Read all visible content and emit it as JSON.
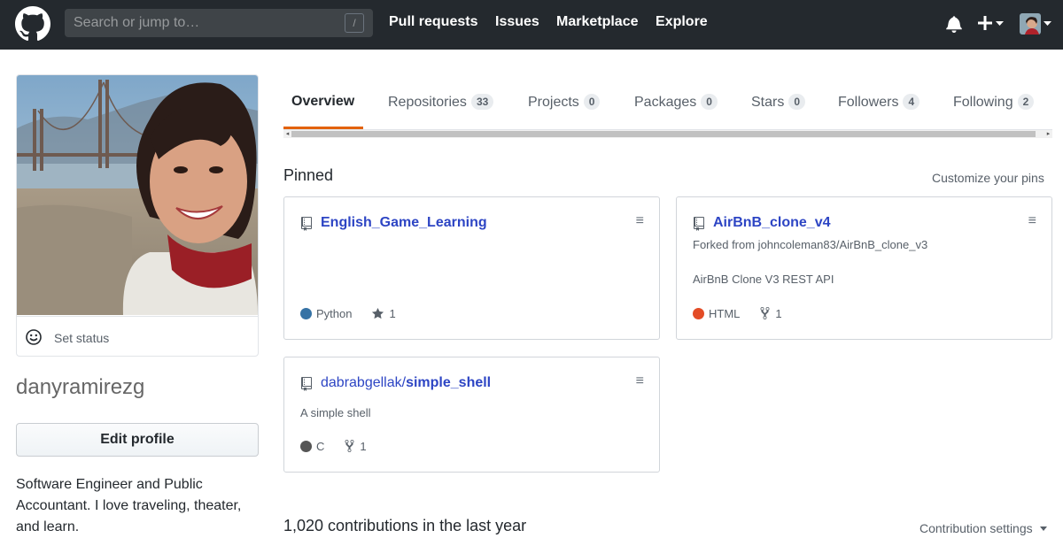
{
  "header": {
    "search_placeholder": "Search or jump to…",
    "search_shortcut": "/",
    "nav": [
      "Pull requests",
      "Issues",
      "Marketplace",
      "Explore"
    ],
    "plus_label": "+"
  },
  "profile": {
    "set_status": "Set status",
    "username": "danyramirezg",
    "edit_button": "Edit profile",
    "bio": "Software Engineer and Public Accountant. I love traveling, theater, and learn."
  },
  "tabs": [
    {
      "label": "Overview",
      "count": null,
      "active": true
    },
    {
      "label": "Repositories",
      "count": "33"
    },
    {
      "label": "Projects",
      "count": "0"
    },
    {
      "label": "Packages",
      "count": "0"
    },
    {
      "label": "Stars",
      "count": "0"
    },
    {
      "label": "Followers",
      "count": "4"
    },
    {
      "label": "Following",
      "count": "2"
    }
  ],
  "pinned": {
    "title": "Pinned",
    "customize": "Customize your pins",
    "repos": [
      {
        "owner": "",
        "name": "English_Game_Learning",
        "forked_from": "",
        "description": "",
        "language": "Python",
        "language_color": "#3572A5",
        "stat_type": "star",
        "stat_value": "1"
      },
      {
        "owner": "",
        "name": "AirBnB_clone_v4",
        "forked_from": "Forked from johncoleman83/AirBnB_clone_v3",
        "description": "AirBnB Clone V3 REST API",
        "language": "HTML",
        "language_color": "#e34c26",
        "stat_type": "fork",
        "stat_value": "1"
      },
      {
        "owner": "dabrabgellak/",
        "name": "simple_shell",
        "forked_from": "",
        "description": "A simple shell",
        "language": "C",
        "language_color": "#555555",
        "stat_type": "fork",
        "stat_value": "1"
      }
    ]
  },
  "contributions": {
    "title": "1,020 contributions in the last year",
    "settings": "Contribution settings"
  }
}
